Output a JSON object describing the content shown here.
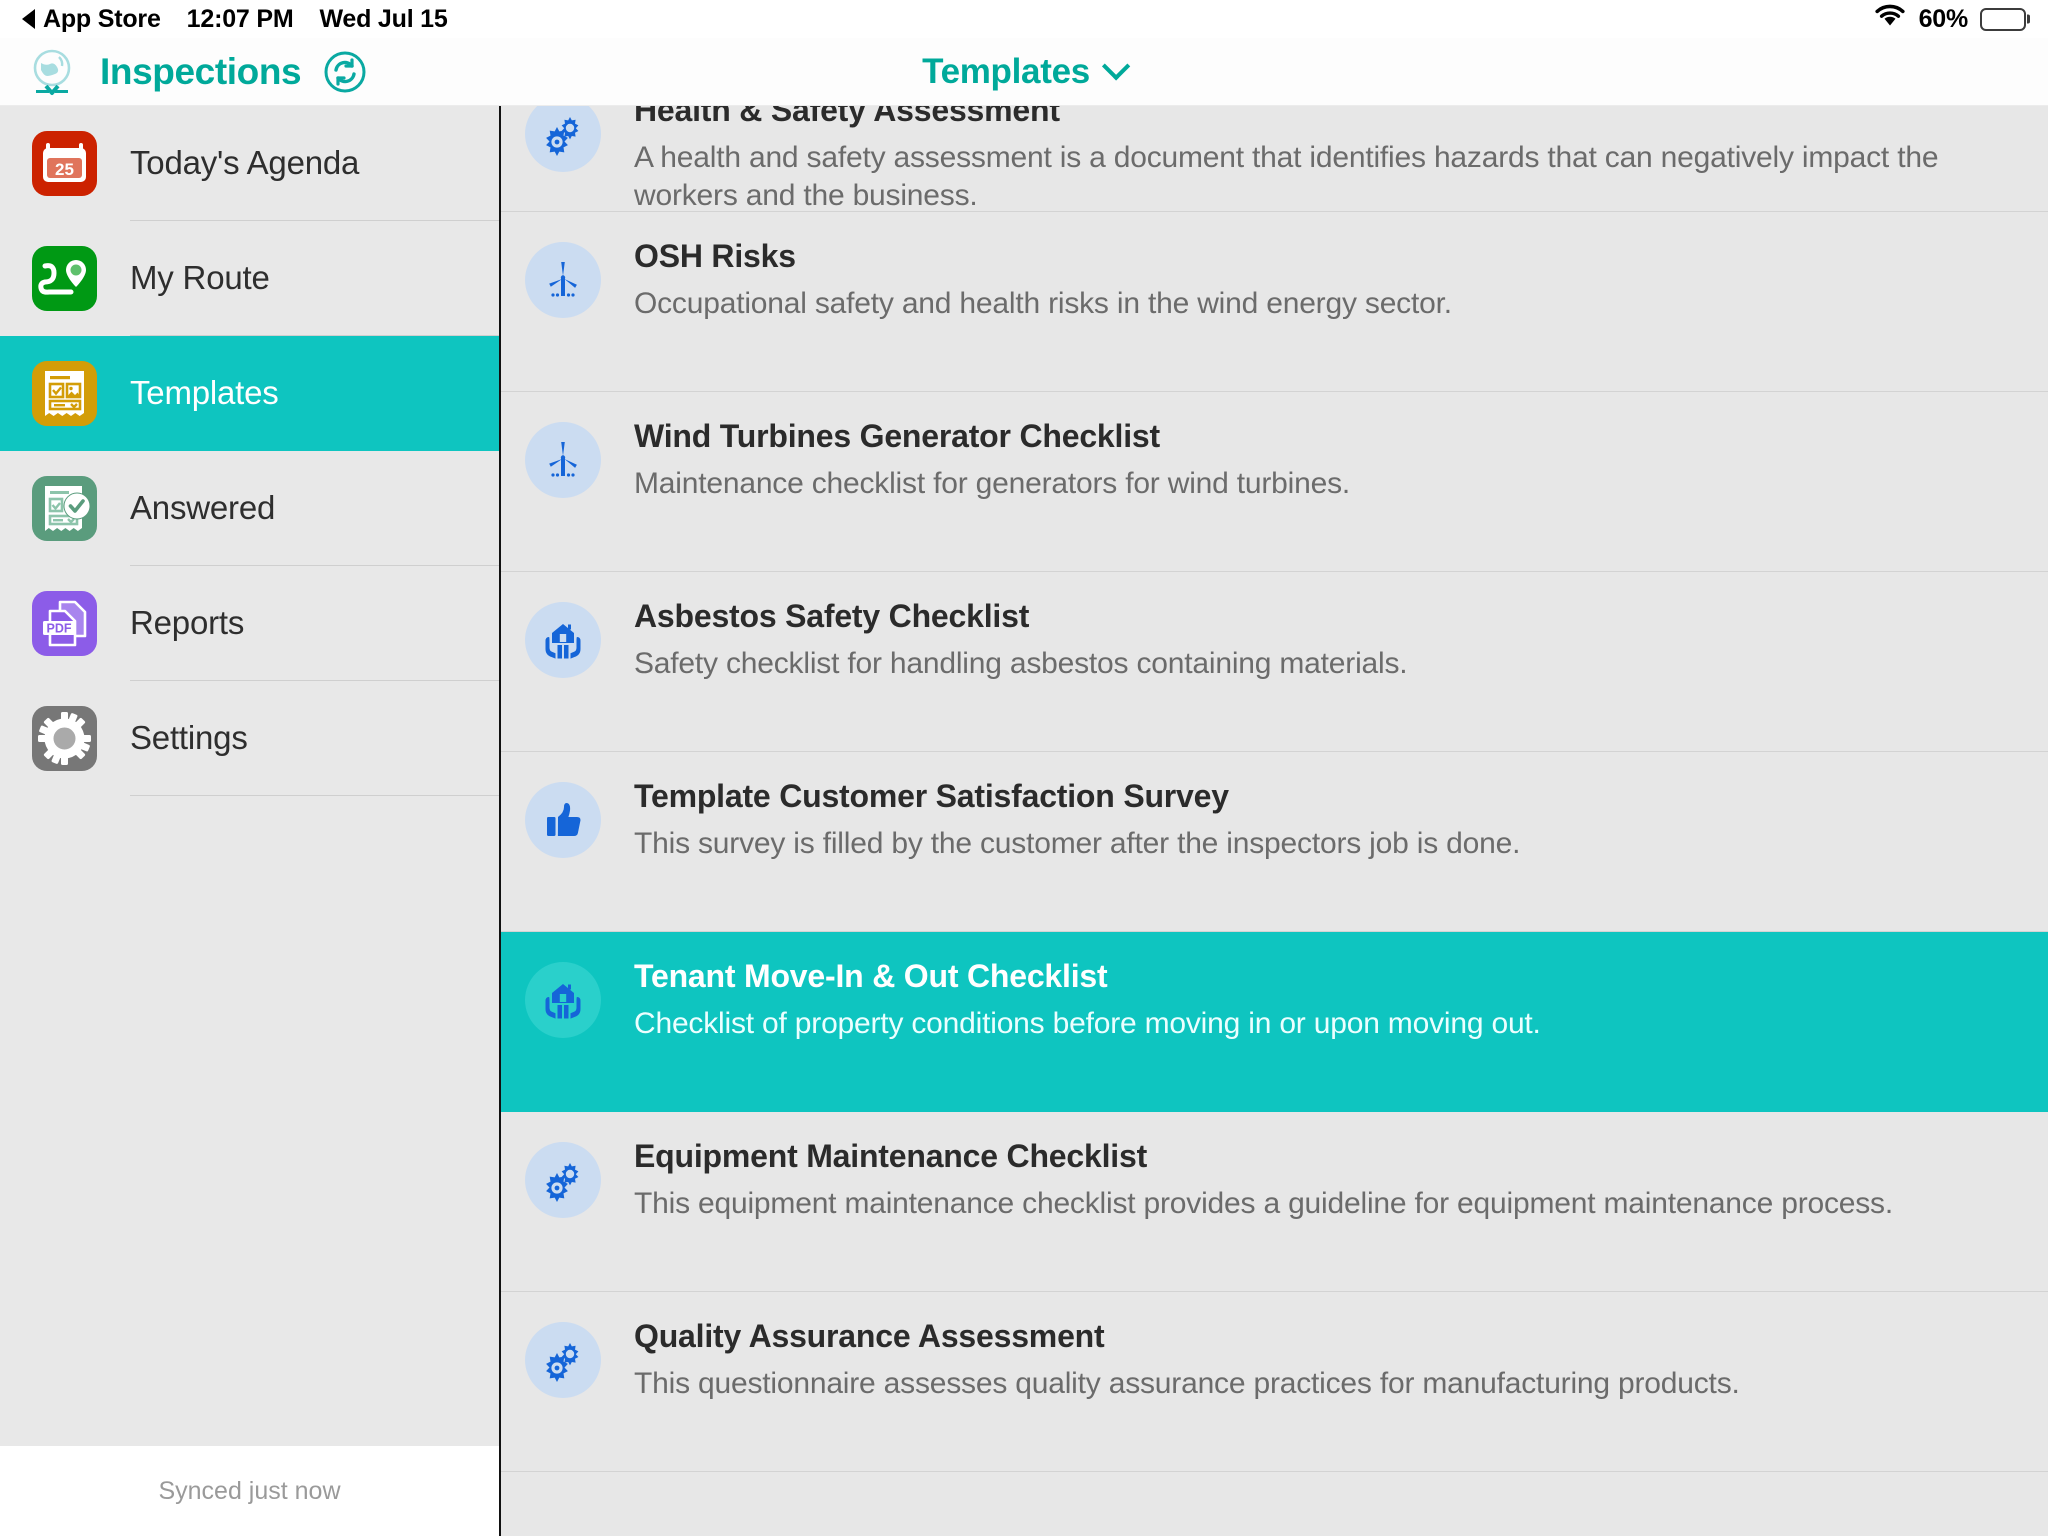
{
  "status_bar": {
    "back_app": "App Store",
    "time": "12:07 PM",
    "date": "Wed Jul 15",
    "battery_percent": "60%",
    "wifi_icon": "wifi-icon",
    "battery_icon": "battery-icon"
  },
  "header": {
    "logo_icon": "globe-airplane-logo-icon",
    "app_title": "Inspections",
    "sync_icon": "sync-refresh-icon",
    "center_label": "Templates",
    "center_chevron_icon": "chevron-down-icon"
  },
  "sidebar": {
    "items": [
      {
        "label": "Today's Agenda",
        "icon": "calendar-icon",
        "icon_color": "#cc2200",
        "badge_day": "25",
        "active": false
      },
      {
        "label": "My Route",
        "icon": "route-map-pin-icon",
        "icon_color": "#009914",
        "active": false
      },
      {
        "label": "Templates",
        "icon": "template-form-icon",
        "icon_color": "#d39d07",
        "active": true
      },
      {
        "label": "Answered",
        "icon": "answered-check-form-icon",
        "icon_color": "#5a9c7d",
        "active": false
      },
      {
        "label": "Reports",
        "icon": "pdf-report-icon",
        "icon_color": "#8c5ce8",
        "active": false,
        "badge_text": "PDF"
      },
      {
        "label": "Settings",
        "icon": "gear-icon",
        "icon_color": "#777777",
        "active": false
      }
    ],
    "footer_status": "Synced just now",
    "active_color": "#0ec5c0"
  },
  "main": {
    "templates": [
      {
        "title": "Health & Safety Assessment",
        "description": "A health and safety assessment is a document that identifies hazards that can negatively impact the workers and the business.",
        "icon": "gears-icon",
        "selected": false,
        "clipped": true
      },
      {
        "title": "OSH Risks",
        "description": "Occupational safety and health risks in the wind energy sector.",
        "icon": "wind-turbine-icon",
        "selected": false,
        "clipped": false
      },
      {
        "title": "Wind Turbines Generator Checklist",
        "description": "Maintenance checklist for generators for wind turbines.",
        "icon": "wind-turbine-icon",
        "selected": false,
        "clipped": false
      },
      {
        "title": "Asbestos Safety Checklist",
        "description": "Safety checklist for handling asbestos containing materials.",
        "icon": "house-in-hands-icon",
        "selected": false,
        "clipped": false
      },
      {
        "title": "Template Customer Satisfaction Survey",
        "description": "This survey is filled by the customer after the inspectors job is done.",
        "icon": "thumbs-up-icon",
        "selected": false,
        "clipped": false
      },
      {
        "title": "Tenant Move-In & Out Checklist",
        "description": "Checklist of property conditions before moving in or upon moving out.",
        "icon": "house-in-hands-icon",
        "selected": true,
        "clipped": false
      },
      {
        "title": "Equipment Maintenance Checklist",
        "description": "This equipment maintenance checklist provides a guideline for equipment maintenance process.",
        "icon": "gears-icon",
        "selected": false,
        "clipped": false
      },
      {
        "title": "Quality Assurance Assessment",
        "description": "This questionnaire assesses quality assurance practices for manufacturing products.",
        "icon": "gears-icon",
        "selected": false,
        "clipped": false
      }
    ],
    "icon_color": "#1565d8",
    "icon_bg": "#cbdcf1",
    "selected_bg": "#0ec5c0"
  }
}
